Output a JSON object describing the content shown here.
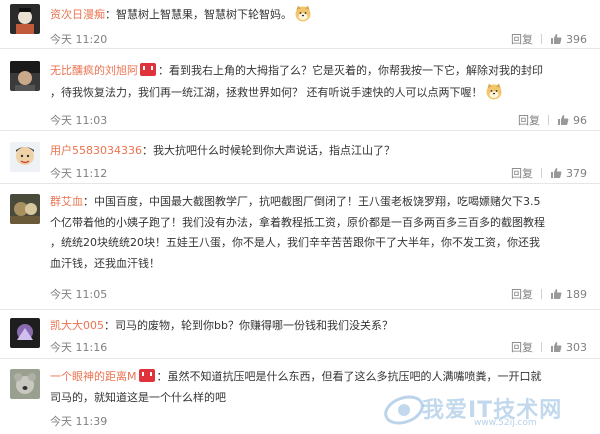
{
  "reply_label": "回复",
  "comments": [
    {
      "user": "资次日漫痴",
      "text": "：智慧树上智慧果，智慧树下轮智妈。",
      "time": "今天 11:20",
      "likes": "396"
    },
    {
      "user": "无比醺疯的刘旭阿",
      "line1": "：看到我右上角的大拇指了么？它是灭着的，你帮我按一下它，解除对我的封印",
      "line2": "，待我恢复法力，我们再一统江湖，拯救世界如何？ 还有听说手速快的人可以点两下喔！",
      "time": "今天 11:03",
      "likes": "96"
    },
    {
      "user": "用户5583034336",
      "text": "：我大抗吧什么时候轮到你大声说话，指点江山了？",
      "time": "今天 11:12",
      "likes": "379"
    },
    {
      "user": "群艾血",
      "line1": "：中国百度，中国最大截图教学厂，抗吧截图厂倒闭了！王八蛋老板饶罗翔，吃喝嫖赌欠下3.5",
      "line2": "个亿带着他的小姨子跑了！我们没有办法，拿着教程抵工资，原价都是一百多两百多三百多的截图教程",
      "line3": "，统统20块统统20块！五娃王八蛋，你不是人，我们辛辛苦苦跟你干了大半年，你不发工资，你还我",
      "line4": "血汗钱，还我血汗钱！",
      "time": "今天 11:05",
      "likes": "189"
    },
    {
      "user": "凯大大005",
      "text": "：司马的废物，轮到你bb？你赚得哪一份钱和我们没关系？",
      "time": "今天 11:16",
      "likes": "303"
    },
    {
      "user": "一个眼神的距离M",
      "line1": "：虽然不知道抗压吧是什么东西，但看了这么多抗压吧的人满嘴喷粪，一开口就",
      "line2": "司马的，就知道这是一个什么样的吧",
      "time": "今天 11:39",
      "likes": ""
    }
  ],
  "watermark": {
    "text": "我爱IT技术网",
    "url": "www.52ij.com"
  },
  "colors": {
    "username": "#eb7350",
    "meta": "#808080",
    "divider": "#e6e6e6",
    "vip_badge": "#e0323a"
  },
  "icons": {
    "emoji": "doge-emoji-icon",
    "like": "thumbs-up-icon",
    "vip": "vip-badge-icon"
  }
}
